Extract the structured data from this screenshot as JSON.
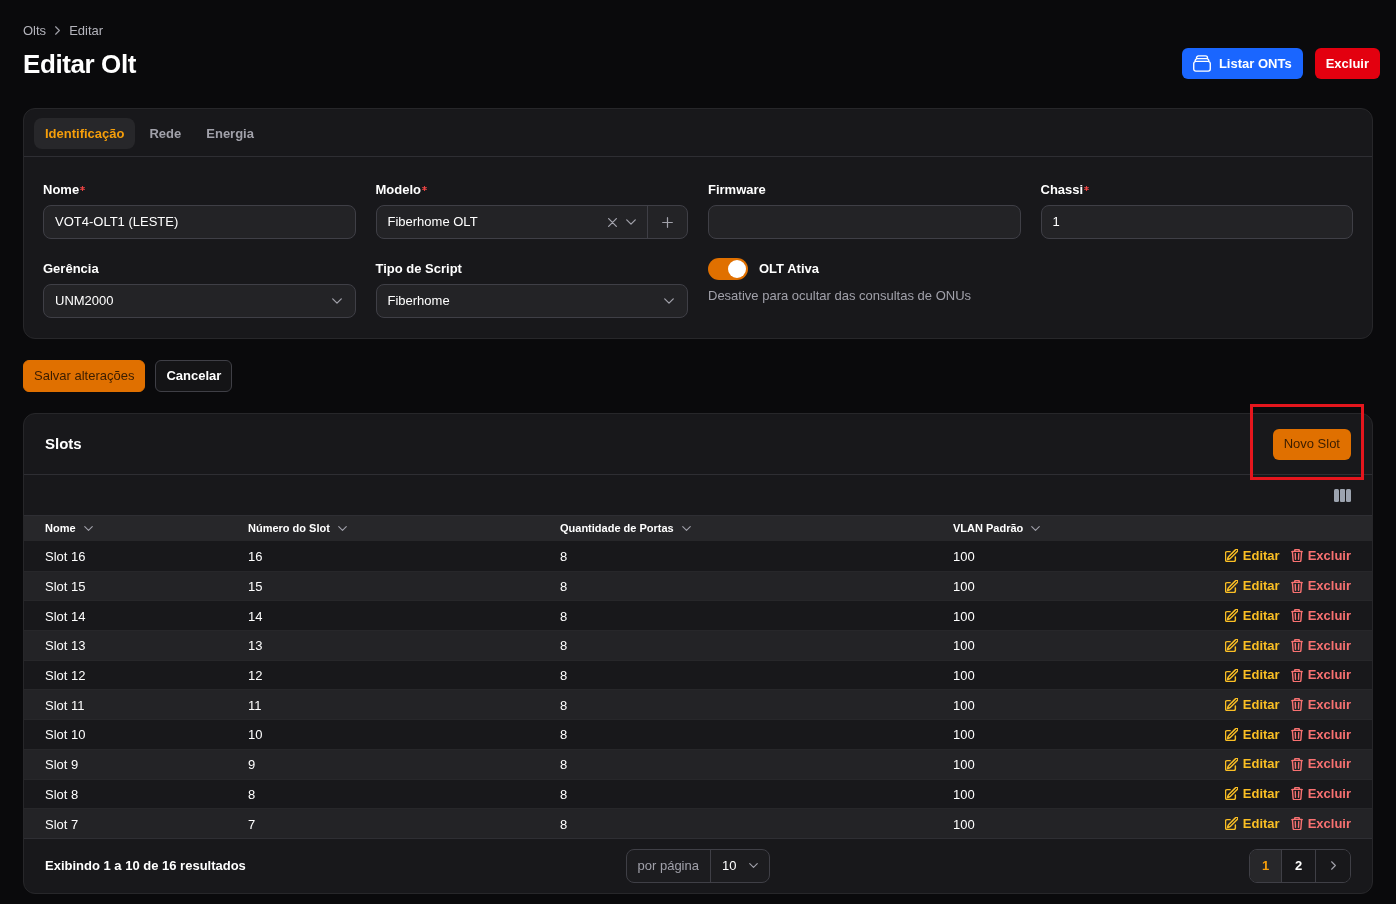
{
  "breadcrumb": [
    {
      "label": "Olts"
    },
    {
      "label": "Editar"
    }
  ],
  "title": "Editar Olt",
  "header_actions": [
    {
      "label": "Listar ONTs",
      "kind": "primary"
    },
    {
      "label": "Excluir",
      "kind": "danger"
    }
  ],
  "form": {
    "tabs": [
      {
        "label": "Identificação",
        "selected": true
      },
      {
        "label": "Rede",
        "selected": false
      },
      {
        "label": "Energia",
        "selected": false
      }
    ],
    "fields": [
      {
        "kind": "text",
        "label": "Nome",
        "required": true,
        "value": "VOT4-OLT1 (LESTE)"
      },
      {
        "kind": "select",
        "label": "Modelo",
        "required": true,
        "value": "Fiberhome OLT",
        "clearable": true,
        "addable": true
      },
      {
        "kind": "text",
        "label": "Firmware",
        "required": false
      },
      {
        "kind": "text",
        "label": "Chassi",
        "required": true,
        "value": "1"
      },
      {
        "kind": "select",
        "label": "Gerência",
        "required": false,
        "value": "UNM2000",
        "clearable": false,
        "addable": false
      },
      {
        "kind": "select",
        "label": "Tipo de Script",
        "required": false,
        "value": "Fiberhome",
        "clearable": false,
        "addable": false
      },
      {
        "kind": "toggle",
        "label": "OLT Ativa",
        "on": true,
        "helper": "Desative para ocultar das consultas de ONUs"
      }
    ]
  },
  "form_actions": [
    {
      "label": "Salvar alterações",
      "kind": "primary"
    },
    {
      "label": "Cancelar",
      "kind": "secondary"
    }
  ],
  "slots": {
    "title": "Slots",
    "new_button": {
      "label": "Novo Slot",
      "highlighted": true
    },
    "columns": [
      {
        "label": "Nome",
        "sortable": true
      },
      {
        "label": "Número do Slot",
        "sortable": true
      },
      {
        "label": "Quantidade de Portas",
        "sortable": true
      },
      {
        "label": "VLAN Padrão",
        "sortable": true
      }
    ],
    "rows": [
      {
        "cells": [
          "Slot 16",
          "16",
          "8",
          "100"
        ],
        "actions": [
          {
            "kind": "edit",
            "label": "Editar"
          },
          {
            "kind": "delete",
            "label": "Excluir"
          }
        ]
      },
      {
        "cells": [
          "Slot 15",
          "15",
          "8",
          "100"
        ],
        "actions": [
          {
            "kind": "edit",
            "label": "Editar"
          },
          {
            "kind": "delete",
            "label": "Excluir"
          }
        ]
      },
      {
        "cells": [
          "Slot 14",
          "14",
          "8",
          "100"
        ],
        "actions": [
          {
            "kind": "edit",
            "label": "Editar"
          },
          {
            "kind": "delete",
            "label": "Excluir"
          }
        ]
      },
      {
        "cells": [
          "Slot 13",
          "13",
          "8",
          "100"
        ],
        "actions": [
          {
            "kind": "edit",
            "label": "Editar"
          },
          {
            "kind": "delete",
            "label": "Excluir"
          }
        ]
      },
      {
        "cells": [
          "Slot 12",
          "12",
          "8",
          "100"
        ],
        "actions": [
          {
            "kind": "edit",
            "label": "Editar"
          },
          {
            "kind": "delete",
            "label": "Excluir"
          }
        ]
      },
      {
        "cells": [
          "Slot 11",
          "11",
          "8",
          "100"
        ],
        "actions": [
          {
            "kind": "edit",
            "label": "Editar"
          },
          {
            "kind": "delete",
            "label": "Excluir"
          }
        ]
      },
      {
        "cells": [
          "Slot 10",
          "10",
          "8",
          "100"
        ],
        "actions": [
          {
            "kind": "edit",
            "label": "Editar"
          },
          {
            "kind": "delete",
            "label": "Excluir"
          }
        ]
      },
      {
        "cells": [
          "Slot 9",
          "9",
          "8",
          "100"
        ],
        "actions": [
          {
            "kind": "edit",
            "label": "Editar"
          },
          {
            "kind": "delete",
            "label": "Excluir"
          }
        ]
      },
      {
        "cells": [
          "Slot 8",
          "8",
          "8",
          "100"
        ],
        "actions": [
          {
            "kind": "edit",
            "label": "Editar"
          },
          {
            "kind": "delete",
            "label": "Excluir"
          }
        ]
      },
      {
        "cells": [
          "Slot 7",
          "7",
          "8",
          "100"
        ],
        "actions": [
          {
            "kind": "edit",
            "label": "Editar"
          },
          {
            "kind": "delete",
            "label": "Excluir"
          }
        ]
      }
    ],
    "summary": "Exibindo 1 a 10 de 16 resultados",
    "per_page": {
      "label": "por página",
      "value": "10"
    },
    "pages": [
      {
        "label": "1",
        "selected": true
      },
      {
        "label": "2",
        "selected": false
      }
    ]
  }
}
